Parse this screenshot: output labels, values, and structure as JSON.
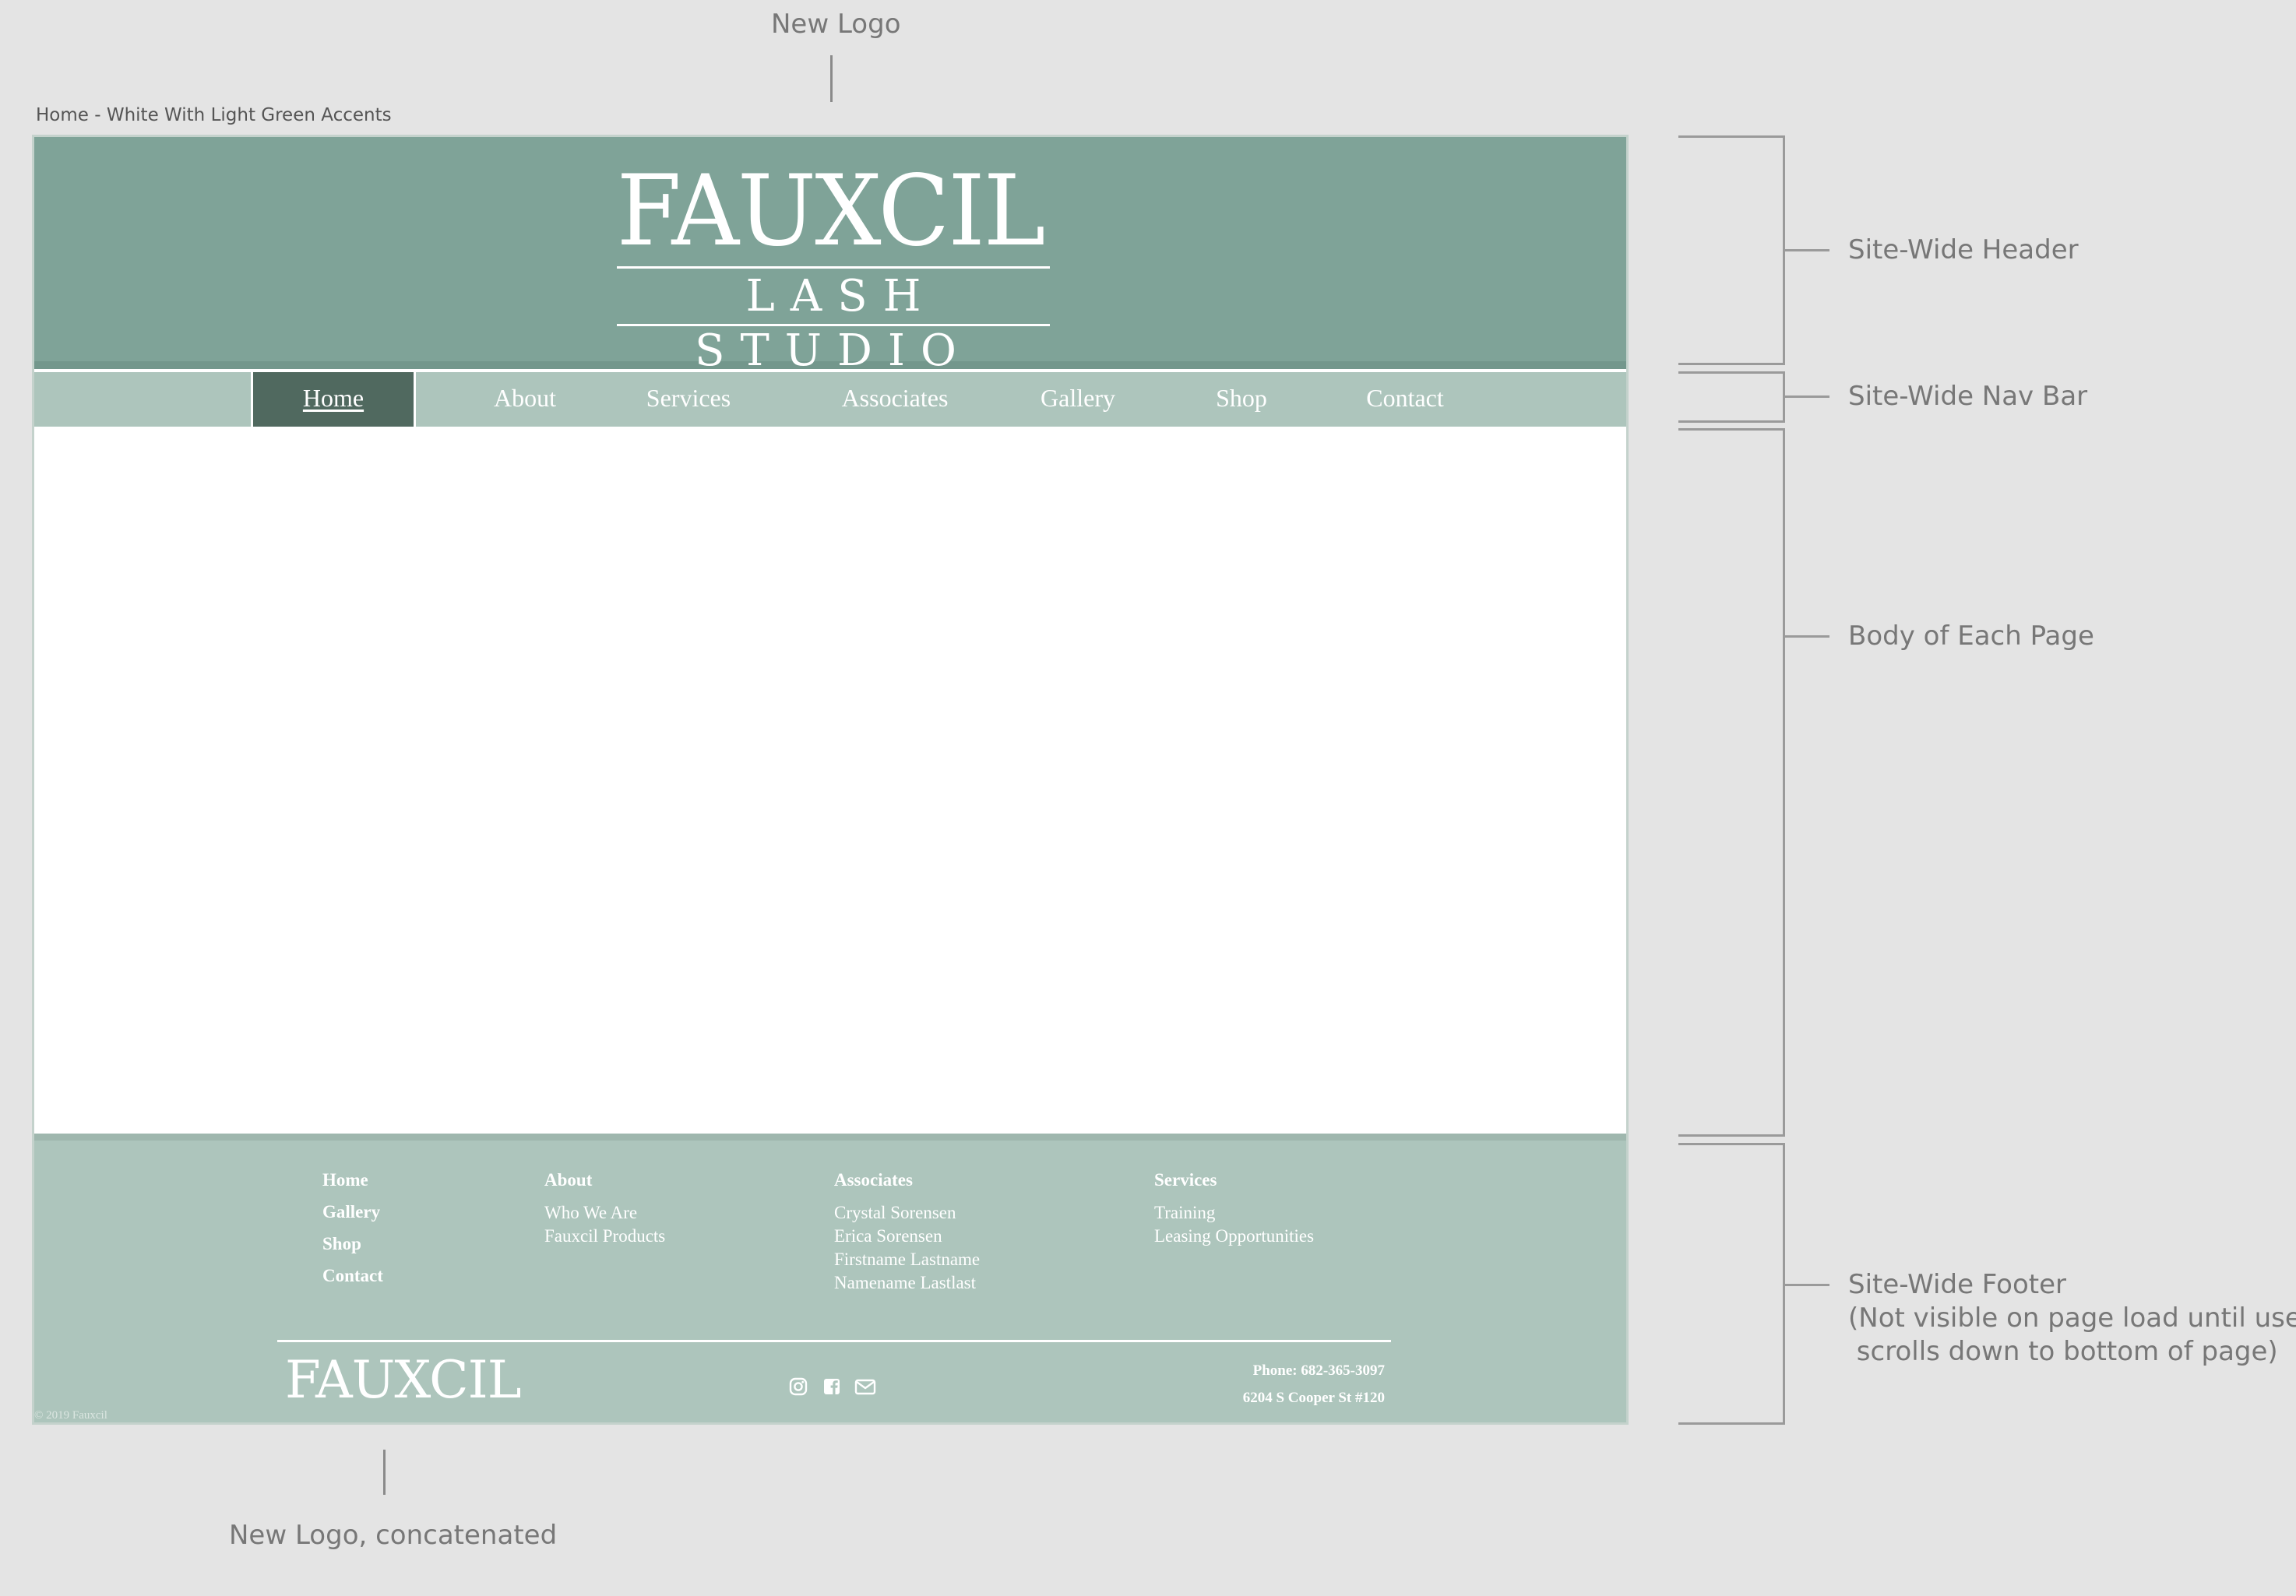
{
  "annotations": {
    "new_logo": "New Logo",
    "new_logo_concatenated": "New Logo, concatenated",
    "frame_label": "Home - White With Light Green Accents",
    "header": "Site-Wide Header",
    "nav_bar": "Site-Wide Nav Bar",
    "body": "Body of Each Page",
    "footer": "Site-Wide Footer\n(Not visible on page load until user\n scrolls down to bottom of page)"
  },
  "header": {
    "logo_title": "FAUXCIL",
    "logo_subtitle": "LASH STUDIO"
  },
  "nav": {
    "active": "Home",
    "items": [
      "Home",
      "About",
      "Services",
      "Associates",
      "Gallery",
      "Shop",
      "Contact"
    ]
  },
  "footer": {
    "col_main": [
      "Home",
      "Gallery",
      "Shop",
      "Contact"
    ],
    "about": {
      "heading": "About",
      "links": [
        "Who We Are",
        "Fauxcil Products"
      ]
    },
    "associates": {
      "heading": "Associates",
      "links": [
        "Crystal Sorensen",
        "Erica Sorensen",
        "Firstname Lastname",
        "Namename Lastlast"
      ]
    },
    "services": {
      "heading": "Services",
      "links": [
        "Training",
        "Leasing Opportunities"
      ]
    },
    "logo": "FAUXCIL",
    "social": [
      "instagram-icon",
      "facebook-icon",
      "email-icon"
    ],
    "phone": "Phone: 682-365-3097",
    "address": "6204 S Cooper St #120",
    "copyright": "© 2019 Fauxcil"
  },
  "colors": {
    "header_bg": "#7fa398",
    "nav_bg": "#adc5bc",
    "nav_active_bg": "#50695f",
    "footer_bg": "#adc5bc",
    "canvas_bg": "#e4e4e4"
  }
}
